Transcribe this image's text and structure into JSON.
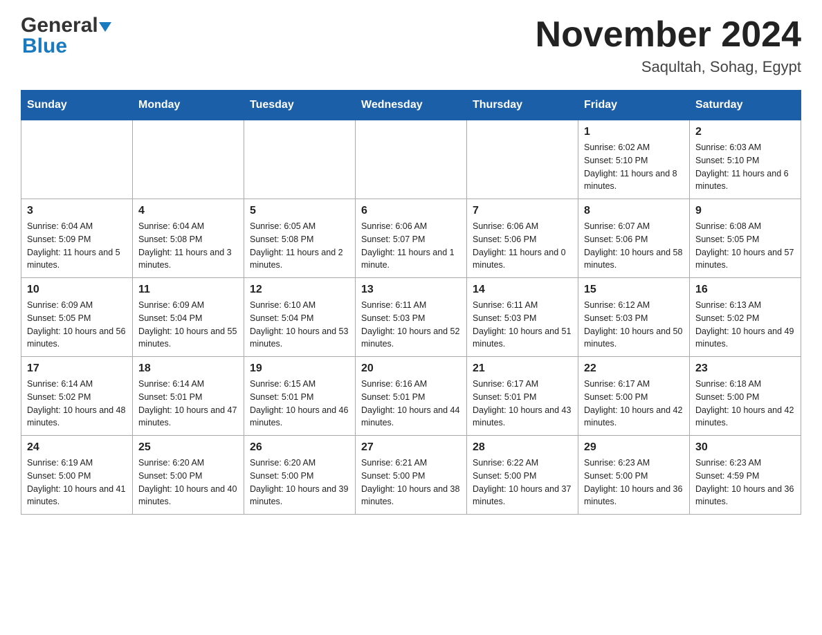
{
  "logo": {
    "general_text": "General",
    "blue_text": "Blue"
  },
  "header": {
    "month_year": "November 2024",
    "location": "Saqultah, Sohag, Egypt"
  },
  "weekdays": [
    "Sunday",
    "Monday",
    "Tuesday",
    "Wednesday",
    "Thursday",
    "Friday",
    "Saturday"
  ],
  "weeks": [
    {
      "days": [
        {
          "date": "",
          "info": ""
        },
        {
          "date": "",
          "info": ""
        },
        {
          "date": "",
          "info": ""
        },
        {
          "date": "",
          "info": ""
        },
        {
          "date": "",
          "info": ""
        },
        {
          "date": "1",
          "info": "Sunrise: 6:02 AM\nSunset: 5:10 PM\nDaylight: 11 hours and 8 minutes."
        },
        {
          "date": "2",
          "info": "Sunrise: 6:03 AM\nSunset: 5:10 PM\nDaylight: 11 hours and 6 minutes."
        }
      ]
    },
    {
      "days": [
        {
          "date": "3",
          "info": "Sunrise: 6:04 AM\nSunset: 5:09 PM\nDaylight: 11 hours and 5 minutes."
        },
        {
          "date": "4",
          "info": "Sunrise: 6:04 AM\nSunset: 5:08 PM\nDaylight: 11 hours and 3 minutes."
        },
        {
          "date": "5",
          "info": "Sunrise: 6:05 AM\nSunset: 5:08 PM\nDaylight: 11 hours and 2 minutes."
        },
        {
          "date": "6",
          "info": "Sunrise: 6:06 AM\nSunset: 5:07 PM\nDaylight: 11 hours and 1 minute."
        },
        {
          "date": "7",
          "info": "Sunrise: 6:06 AM\nSunset: 5:06 PM\nDaylight: 11 hours and 0 minutes."
        },
        {
          "date": "8",
          "info": "Sunrise: 6:07 AM\nSunset: 5:06 PM\nDaylight: 10 hours and 58 minutes."
        },
        {
          "date": "9",
          "info": "Sunrise: 6:08 AM\nSunset: 5:05 PM\nDaylight: 10 hours and 57 minutes."
        }
      ]
    },
    {
      "days": [
        {
          "date": "10",
          "info": "Sunrise: 6:09 AM\nSunset: 5:05 PM\nDaylight: 10 hours and 56 minutes."
        },
        {
          "date": "11",
          "info": "Sunrise: 6:09 AM\nSunset: 5:04 PM\nDaylight: 10 hours and 55 minutes."
        },
        {
          "date": "12",
          "info": "Sunrise: 6:10 AM\nSunset: 5:04 PM\nDaylight: 10 hours and 53 minutes."
        },
        {
          "date": "13",
          "info": "Sunrise: 6:11 AM\nSunset: 5:03 PM\nDaylight: 10 hours and 52 minutes."
        },
        {
          "date": "14",
          "info": "Sunrise: 6:11 AM\nSunset: 5:03 PM\nDaylight: 10 hours and 51 minutes."
        },
        {
          "date": "15",
          "info": "Sunrise: 6:12 AM\nSunset: 5:03 PM\nDaylight: 10 hours and 50 minutes."
        },
        {
          "date": "16",
          "info": "Sunrise: 6:13 AM\nSunset: 5:02 PM\nDaylight: 10 hours and 49 minutes."
        }
      ]
    },
    {
      "days": [
        {
          "date": "17",
          "info": "Sunrise: 6:14 AM\nSunset: 5:02 PM\nDaylight: 10 hours and 48 minutes."
        },
        {
          "date": "18",
          "info": "Sunrise: 6:14 AM\nSunset: 5:01 PM\nDaylight: 10 hours and 47 minutes."
        },
        {
          "date": "19",
          "info": "Sunrise: 6:15 AM\nSunset: 5:01 PM\nDaylight: 10 hours and 46 minutes."
        },
        {
          "date": "20",
          "info": "Sunrise: 6:16 AM\nSunset: 5:01 PM\nDaylight: 10 hours and 44 minutes."
        },
        {
          "date": "21",
          "info": "Sunrise: 6:17 AM\nSunset: 5:01 PM\nDaylight: 10 hours and 43 minutes."
        },
        {
          "date": "22",
          "info": "Sunrise: 6:17 AM\nSunset: 5:00 PM\nDaylight: 10 hours and 42 minutes."
        },
        {
          "date": "23",
          "info": "Sunrise: 6:18 AM\nSunset: 5:00 PM\nDaylight: 10 hours and 42 minutes."
        }
      ]
    },
    {
      "days": [
        {
          "date": "24",
          "info": "Sunrise: 6:19 AM\nSunset: 5:00 PM\nDaylight: 10 hours and 41 minutes."
        },
        {
          "date": "25",
          "info": "Sunrise: 6:20 AM\nSunset: 5:00 PM\nDaylight: 10 hours and 40 minutes."
        },
        {
          "date": "26",
          "info": "Sunrise: 6:20 AM\nSunset: 5:00 PM\nDaylight: 10 hours and 39 minutes."
        },
        {
          "date": "27",
          "info": "Sunrise: 6:21 AM\nSunset: 5:00 PM\nDaylight: 10 hours and 38 minutes."
        },
        {
          "date": "28",
          "info": "Sunrise: 6:22 AM\nSunset: 5:00 PM\nDaylight: 10 hours and 37 minutes."
        },
        {
          "date": "29",
          "info": "Sunrise: 6:23 AM\nSunset: 5:00 PM\nDaylight: 10 hours and 36 minutes."
        },
        {
          "date": "30",
          "info": "Sunrise: 6:23 AM\nSunset: 4:59 PM\nDaylight: 10 hours and 36 minutes."
        }
      ]
    }
  ]
}
